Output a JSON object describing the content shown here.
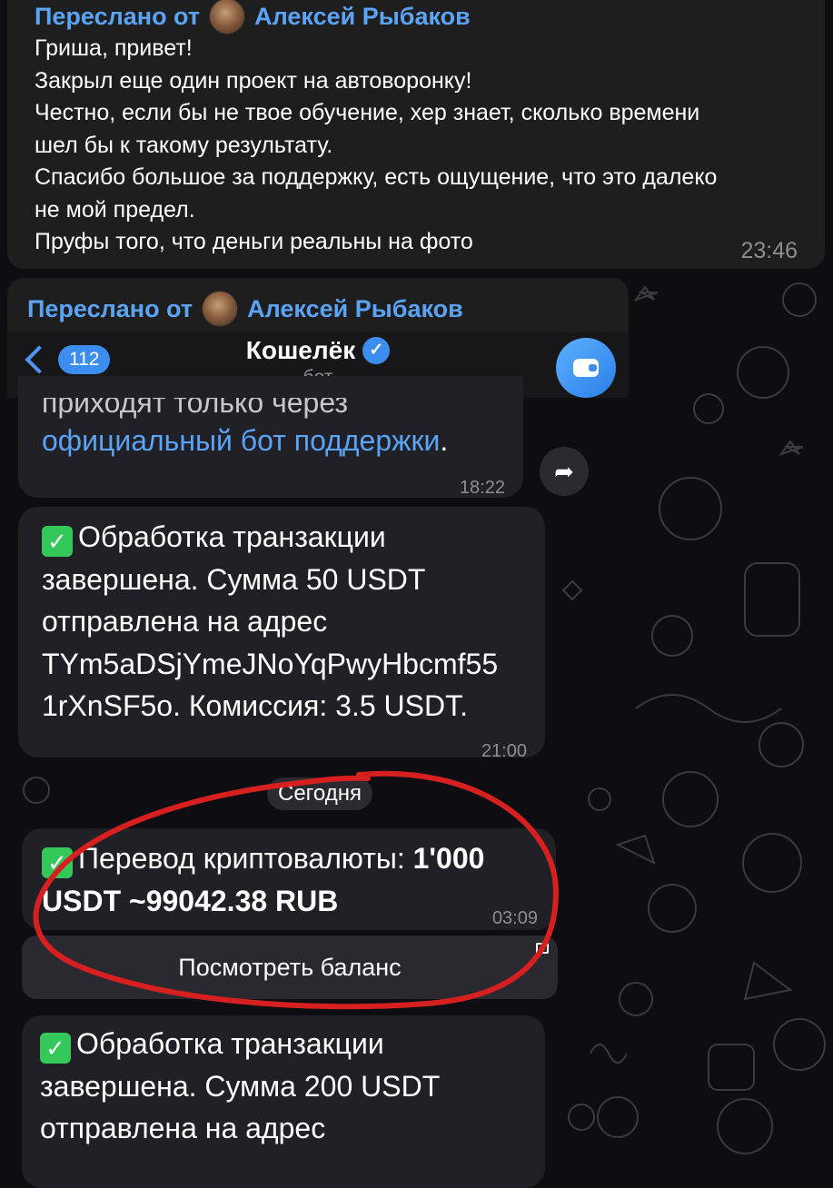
{
  "forward": {
    "prefix": "Переслано от",
    "author": "Алексей Рыбаков"
  },
  "top_message": {
    "lines": [
      "Гриша, привет!",
      "Закрыл еще один проект на автоворонку!",
      "Честно, если бы не твое обучение, хер знает, сколько времени",
      "шел бы к такому результату.",
      "Спасибо большое за поддержку, есть ощущение, что это далеко",
      "не мой предел.",
      "Пруфы того, что деньги реальны на фото"
    ],
    "time": "23:46"
  },
  "chat_header": {
    "back_badge": "112",
    "title": "Кошелёк",
    "subtitle": "бот",
    "verified_icon": "verified-icon",
    "avatar_icon": "wallet-icon"
  },
  "messages": {
    "m1": {
      "line1": "приходят только через",
      "link": "официальный бот поддержки",
      "trail": ".",
      "time": "18:22"
    },
    "m2": {
      "lines": [
        "Обработка транзакции",
        "завершена. Сумма 50 USDT",
        "отправлена на адрес",
        "TYm5aDSjYmeJNoYqPwyHbcmf55",
        "1rXnSF5o. Комиссия: 3.5 USDT."
      ],
      "time": "21:00"
    },
    "date_separator": "Сегодня",
    "m3": {
      "prefix": "Перевод криптовалюты: ",
      "bold1": "1'000",
      "bold2": "USDT ~99042.38 RUB",
      "time": "03:09"
    },
    "keyboard_button": "Посмотреть баланс",
    "m4": {
      "lines": [
        "Обработка транзакции",
        "завершена. Сумма 200 USDT",
        "отправлена на адрес"
      ]
    }
  },
  "colors": {
    "link": "#5aa3f5",
    "accent": "#3b8ef0",
    "annotation": "#d6201f",
    "check": "#34c759"
  }
}
